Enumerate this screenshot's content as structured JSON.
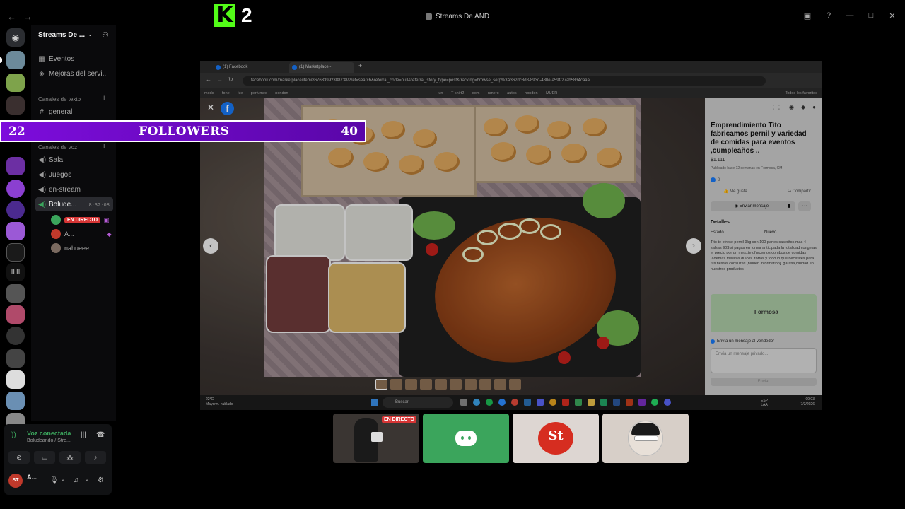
{
  "app": {
    "window_title": "Streams De AND",
    "overlay_logo_text": "2"
  },
  "colors": {
    "discord_green": "#3ba55c",
    "live_red": "#d63535",
    "followers_purple": "#7d0ddc",
    "kick_green": "#53fc18",
    "fb_blue": "#1877f2"
  },
  "sidebar": {
    "guild_name": "Streams De ...",
    "top_items": [
      {
        "label": "Eventos",
        "icon": "calendar-icon"
      },
      {
        "label": "Mejoras del servi...",
        "icon": "boost-icon"
      }
    ],
    "text_category": "Canales de texto",
    "text_channels": [
      {
        "label": "general",
        "icon": "hash-icon"
      }
    ],
    "voice_category": "Canales de voz",
    "voice_channels": [
      {
        "label": "Sala"
      },
      {
        "label": "Juegos"
      },
      {
        "label": "en-stream"
      },
      {
        "label": "Bolude...",
        "timer": "8:32:08"
      }
    ],
    "voice_users": [
      {
        "name": "",
        "badge": "EN DIRECTO"
      },
      {
        "name": "A..."
      },
      {
        "name": "nahueee"
      }
    ]
  },
  "voice_panel": {
    "status": "Voz conectada",
    "channel": "Boludeando / Stre...",
    "user_name": "A...",
    "avatar_text": "ST"
  },
  "overlay": {
    "left_count": "22",
    "label": "FOLLOWERS",
    "right_count": "40"
  },
  "browser": {
    "tabs": [
      "(1) Facebook",
      "(1) Marketplace - Emprendimi..."
    ],
    "url": "facebook.com/marketplace/item/867633992388738/?ref=search&referral_code=null&referral_story_type=post&tracking=browse_serp%3A362dc8d8-893d-480e-a59f-27ab5834caaa",
    "bookmarks": [
      "mods",
      "fone",
      "kie",
      "perfumes",
      "nondon",
      "lun",
      "T-shirt2",
      "dom",
      "nmero",
      "autos",
      "nondon",
      "MUER"
    ],
    "bookmarks_right": "Todos los favoritos"
  },
  "listing": {
    "title": "Emprendimiento Tito fabricamos pernil y variedad de comidas para eventos ,cumpleaños ..",
    "price": "$1.111",
    "meta": "Publicado hace 12 semanas en Formosa, CM",
    "likes": "2",
    "like_label": "Me gusta",
    "share_label": "Compartir",
    "send_message": "Enviar mensaje",
    "details_heading": "Detalles",
    "condition_label": "Estado",
    "condition_value": "Nuevo",
    "description": "Tito te ofrese pernil 9kg con 100 panes caseritos mas 4 salsas 90$  si pagas  en forma anticipada la totalidad congelas el precio por un mes..te ofrecemos combos de comidas ,ademas mesitas dulces ,tortas y todo lo que necesites para tus fiestas consultas [hidden information]..garatia,calidad en nuestros productos",
    "map_label": "Formosa",
    "message_heading": "Envía un mensaje al vendedor",
    "message_placeholder": "Envía un mensaje privado...",
    "send_button": "Enviar"
  },
  "taskbar": {
    "weather_temp": "22°C",
    "weather_desc": "Mayorm. nublado",
    "search": "Buscar",
    "lang": "ESP",
    "lang2": "LAA",
    "time": "09:03",
    "date": "7/3/2026"
  },
  "tiles": [
    {
      "name": "streamer-tile",
      "badge": "EN DIRECTO"
    },
    {
      "name": "discord-tile"
    },
    {
      "name": "stallium-tile",
      "text": "St"
    },
    {
      "name": "avatar-tile"
    }
  ]
}
